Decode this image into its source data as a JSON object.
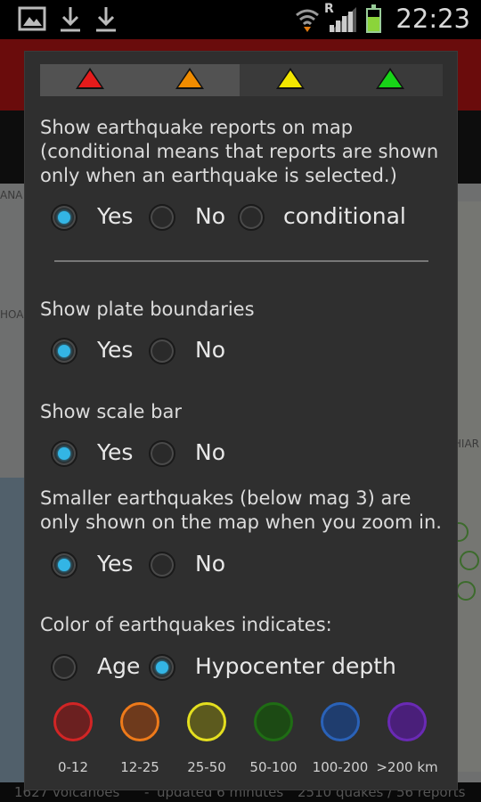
{
  "status_bar": {
    "time": "22:23",
    "network_indicator": "R",
    "icons": [
      "image-icon",
      "download-icon",
      "download-icon",
      "wifi-icon",
      "signal-icon",
      "battery-icon"
    ]
  },
  "background": {
    "map_labels": [
      "ANA",
      "HOA",
      "HIAR"
    ],
    "footer": [
      "1627 volcanoes",
      "-",
      "updated 6 minutes",
      "2510 quakes / 56 reports"
    ]
  },
  "legend_triangles": {
    "colors": [
      "#e51b1b",
      "#f08c00",
      "#f2e600",
      "#18d418"
    ],
    "selected_index_range": [
      0,
      1
    ]
  },
  "settings": {
    "reports": {
      "title_lines": [
        "Show earthquake reports on map",
        "(conditional means that reports are shown",
        "only when an earthquake is selected.)"
      ],
      "options": [
        "Yes",
        "No",
        "conditional"
      ],
      "selected": "Yes"
    },
    "plate_boundaries": {
      "title": "Show plate boundaries",
      "options": [
        "Yes",
        "No"
      ],
      "selected": "Yes"
    },
    "scale_bar": {
      "title": "Show scale bar",
      "options": [
        "Yes",
        "No"
      ],
      "selected": "Yes"
    },
    "small_quakes": {
      "title_lines": [
        "Smaller earthquakes (below mag 3) are",
        "only shown on the map when you zoom in."
      ],
      "options": [
        "Yes",
        "No"
      ],
      "selected": "Yes"
    },
    "color_mode": {
      "title": "Color of earthquakes indicates:",
      "options": [
        "Age",
        "Hypocenter depth"
      ],
      "selected": "Hypocenter depth"
    }
  },
  "depth_legend": {
    "items": [
      {
        "label": "0-12",
        "fill": "#6b2020",
        "stroke": "#d22525"
      },
      {
        "label": "12-25",
        "fill": "#6e3a1c",
        "stroke": "#ee7a1a"
      },
      {
        "label": "25-50",
        "fill": "#5c5a1e",
        "stroke": "#e4df1f"
      },
      {
        "label": "50-100",
        "fill": "#1c4a14",
        "stroke": "#1f6d14"
      },
      {
        "label": "100-200",
        "fill": "#1f3d6e",
        "stroke": "#2a62b8"
      },
      {
        "label": ">200 km",
        "fill": "#4a1f7a",
        "stroke": "#6a2ab5"
      }
    ]
  }
}
